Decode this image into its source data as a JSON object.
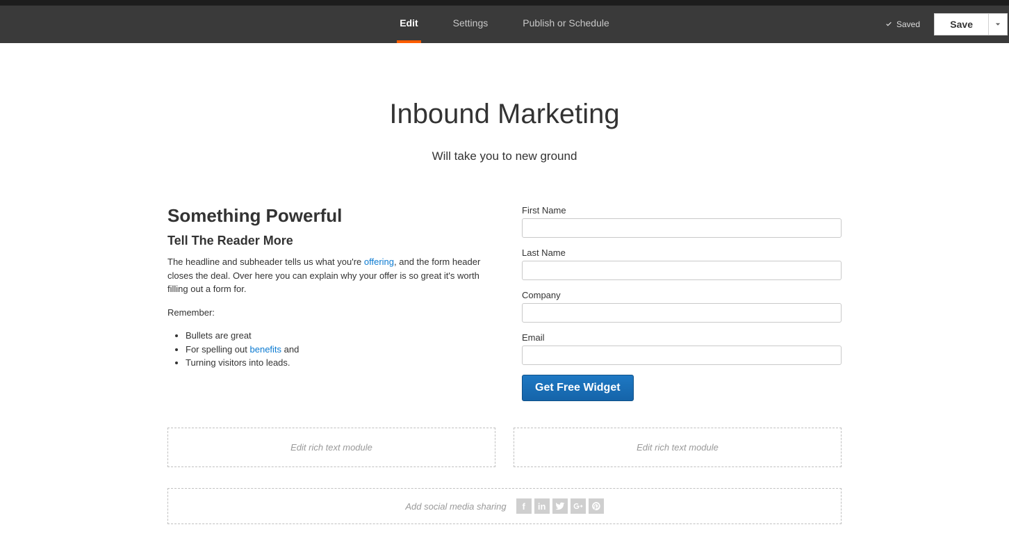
{
  "header": {
    "tabs": {
      "edit": "Edit",
      "settings": "Settings",
      "publish": "Publish or Schedule"
    },
    "saved": "Saved",
    "save": "Save"
  },
  "hero": {
    "title": "Inbound Marketing",
    "subtitle": "Will take you to new ground"
  },
  "content": {
    "heading": "Something Powerful",
    "subheading": "Tell The Reader More",
    "p1a": "The headline and subheader tells us what you're ",
    "p1link": "offering",
    "p1b": ", and the form header closes the deal. Over here you can explain why your offer is so great it's worth filling out a form for.",
    "remember": "Remember:",
    "li1": "Bullets are great",
    "li2a": "For spelling out ",
    "li2link": "benefits",
    "li2b": " and",
    "li3": "Turning visitors into leads."
  },
  "form": {
    "first_name": "First Name",
    "last_name": "Last Name",
    "company": "Company",
    "email": "Email",
    "cta": "Get Free Widget"
  },
  "modules": {
    "left": "Edit rich text module",
    "right": "Edit rich text module"
  },
  "social": {
    "label": "Add social media sharing"
  }
}
